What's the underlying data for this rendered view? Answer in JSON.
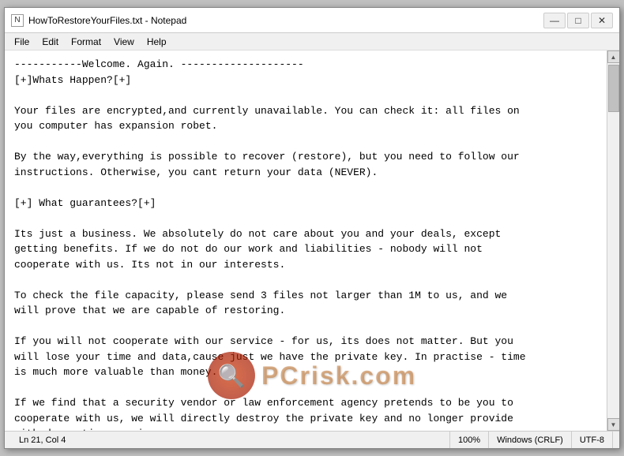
{
  "window": {
    "title": "HowToRestoreYourFiles.txt - Notepad",
    "icon_label": "N"
  },
  "title_buttons": {
    "minimize": "—",
    "maximize": "□",
    "close": "✕"
  },
  "menu": {
    "items": [
      "File",
      "Edit",
      "Format",
      "View",
      "Help"
    ]
  },
  "content": {
    "text": "-----------Welcome. Again. --------------------\n[+]Whats Happen?[+]\n\nYour files are encrypted,and currently unavailable. You can check it: all files on\nyou computer has expansion robet.\n\nBy the way,everything is possible to recover (restore), but you need to follow our\ninstructions. Otherwise, you cant return your data (NEVER).\n\n[+] What guarantees?[+]\n\nIts just a business. We absolutely do not care about you and your deals, except\ngetting benefits. If we do not do our work and liabilities - nobody will not\ncooperate with us. Its not in our interests.\n\nTo check the file capacity, please send 3 files not larger than 1M to us, and we\nwill prove that we are capable of restoring.\n\nIf you will not cooperate with our service - for us, its does not matter. But you\nwill lose your time and data,cause just we have the private key. In practise - time\nis much more valuable than money.\n\nIf we find that a security vendor or law enforcement agency pretends to be you to\ncooperate with us, we will directly destroy the private key and no longer provide\nwith decryption services."
  },
  "status_bar": {
    "line_col": "Ln 21, Col 4",
    "zoom": "100%",
    "line_ending": "Windows (CRLF)",
    "encoding": "UTF-8"
  },
  "watermark": {
    "icon_symbol": "🔍",
    "text": "PCrisk.com"
  }
}
